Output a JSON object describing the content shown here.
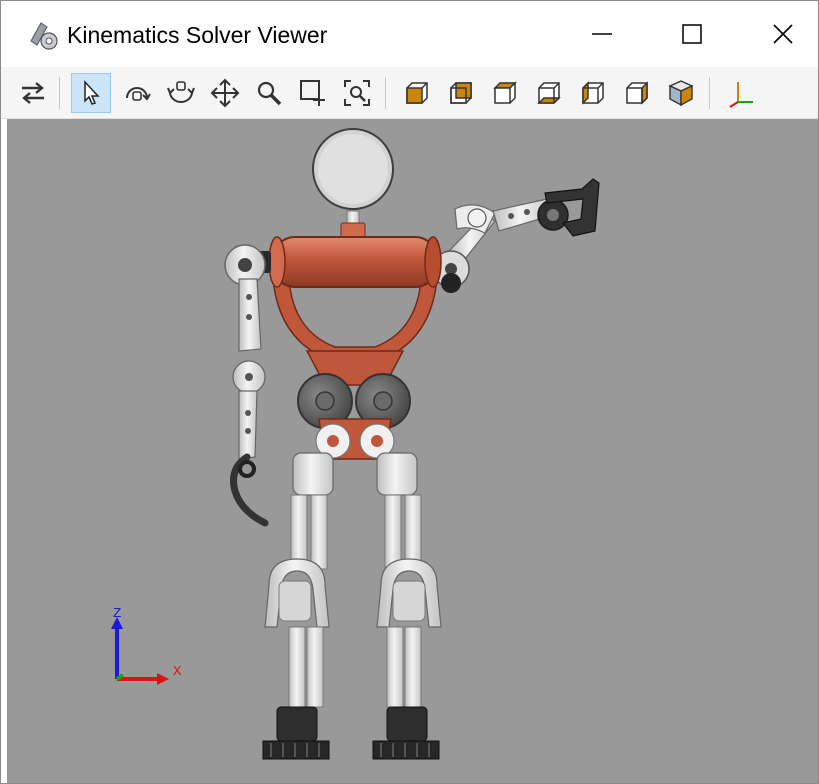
{
  "window": {
    "title": "Kinematics Solver Viewer",
    "controls": [
      "minimize",
      "maximize",
      "close"
    ]
  },
  "toolbar": {
    "buttons": [
      {
        "name": "swap-arrows-icon",
        "active": false
      },
      {
        "name": "select-pointer-icon",
        "active": true
      },
      {
        "name": "orbit-icon",
        "active": false
      },
      {
        "name": "rotate-icon",
        "active": false
      },
      {
        "name": "pan-move-icon",
        "active": false
      },
      {
        "name": "zoom-icon",
        "active": false
      },
      {
        "name": "zoom-window-icon",
        "active": false
      },
      {
        "name": "zoom-fit-icon",
        "active": false
      },
      {
        "name": "view-front-icon",
        "active": false
      },
      {
        "name": "view-back-icon",
        "active": false
      },
      {
        "name": "view-top-icon",
        "active": false
      },
      {
        "name": "view-bottom-icon",
        "active": false
      },
      {
        "name": "view-left-icon",
        "active": false
      },
      {
        "name": "view-right-icon",
        "active": false
      },
      {
        "name": "view-iso-icon",
        "active": false
      },
      {
        "name": "axes-triad-icon",
        "active": false
      }
    ]
  },
  "viewport": {
    "background": "#999999",
    "axis_labels": {
      "z": "Z",
      "x": "X"
    },
    "colors": {
      "torso": "#c0573a",
      "metal": "#e6e6e6",
      "dark": "#555555",
      "z_axis": "#1a1adc",
      "x_axis": "#e01010",
      "y_axis": "#1aa01a"
    }
  }
}
